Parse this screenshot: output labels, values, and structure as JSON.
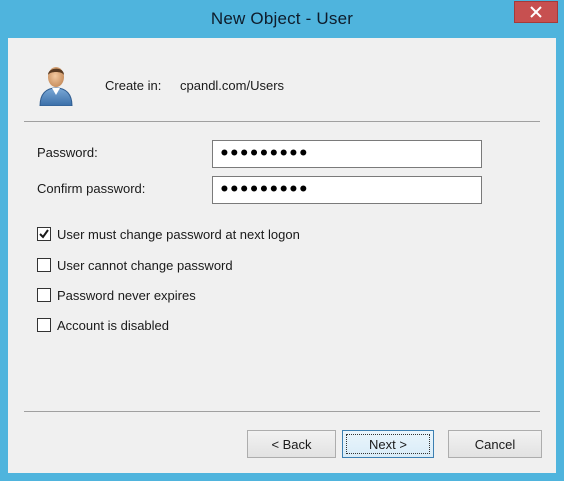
{
  "window": {
    "title": "New Object - User"
  },
  "header": {
    "create_in_label": "Create in:",
    "create_in_path": "cpandl.com/Users",
    "icon": "user-icon"
  },
  "form": {
    "password_label": "Password:",
    "password_value": "•••••••••",
    "confirm_label": "Confirm password:",
    "confirm_value": "•••••••••"
  },
  "options": [
    {
      "label": "User must change password at next logon",
      "checked": true
    },
    {
      "label": "User cannot change password",
      "checked": false
    },
    {
      "label": "Password never expires",
      "checked": false
    },
    {
      "label": "Account is disabled",
      "checked": false
    }
  ],
  "buttons": {
    "back": "< Back",
    "next": "Next >",
    "cancel": "Cancel"
  },
  "colors": {
    "frame": "#4fb4dd",
    "close": "#c75050",
    "client": "#f0f0f0"
  }
}
